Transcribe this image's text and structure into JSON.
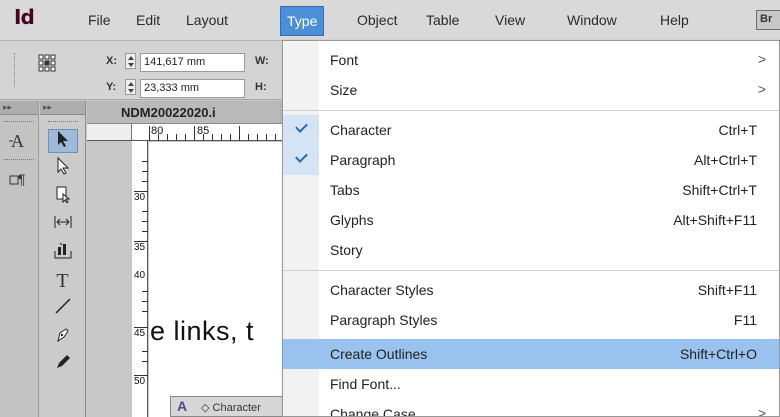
{
  "app": {
    "logo": "Id",
    "bridge_badge": "Br"
  },
  "menubar": {
    "items": [
      "File",
      "Edit",
      "Layout",
      "Type",
      "Object",
      "Table",
      "View",
      "Window",
      "Help"
    ],
    "active": "Type"
  },
  "control_panel": {
    "x_label": "X:",
    "x_value": "141,617 mm",
    "y_label": "Y:",
    "y_value": "23,333 mm",
    "w_label": "W:",
    "h_label": "H:"
  },
  "document": {
    "tab_title": "NDM20022020.i",
    "ruler_h": [
      "80",
      "85"
    ],
    "ruler_v": [
      "30",
      "35",
      "40",
      "45",
      "50"
    ],
    "body_text": "e links, t",
    "char_panel_label": "◇ Character"
  },
  "type_menu": {
    "items": [
      {
        "label": "Font",
        "shortcut": "",
        "submenu": true,
        "checked": false
      },
      {
        "label": "Size",
        "shortcut": "",
        "submenu": true,
        "checked": false
      },
      {
        "label": "Character",
        "shortcut": "Ctrl+T",
        "submenu": false,
        "checked": true
      },
      {
        "label": "Paragraph",
        "shortcut": "Alt+Ctrl+T",
        "submenu": false,
        "checked": true
      },
      {
        "label": "Tabs",
        "shortcut": "Shift+Ctrl+T",
        "submenu": false,
        "checked": false
      },
      {
        "label": "Glyphs",
        "shortcut": "Alt+Shift+F11",
        "submenu": false,
        "checked": false
      },
      {
        "label": "Story",
        "shortcut": "",
        "submenu": false,
        "checked": false
      },
      {
        "label": "Character Styles",
        "shortcut": "Shift+F11",
        "submenu": false,
        "checked": false
      },
      {
        "label": "Paragraph Styles",
        "shortcut": "F11",
        "submenu": false,
        "checked": false
      },
      {
        "label": "Create Outlines",
        "shortcut": "Shift+Ctrl+O",
        "submenu": false,
        "checked": false,
        "highlighted": true
      },
      {
        "label": "Find Font...",
        "shortcut": "",
        "submenu": false,
        "checked": false
      },
      {
        "label": "Change Case",
        "shortcut": "",
        "submenu": true,
        "checked": false
      }
    ]
  },
  "icons": {
    "reference_point": "reference-point-icon",
    "selection": "selection-tool-icon",
    "direct_selection": "direct-selection-tool-icon",
    "page": "page-tool-icon",
    "gap": "gap-tool-icon",
    "content_collector": "content-collector-icon",
    "type": "type-tool-icon",
    "line": "line-tool-icon",
    "pen": "pen-tool-icon",
    "pencil": "pencil-tool-icon"
  },
  "colors": {
    "menu_highlight": "#99c3ee",
    "active_menu": "#4b8fd6",
    "logo": "#49021f"
  }
}
